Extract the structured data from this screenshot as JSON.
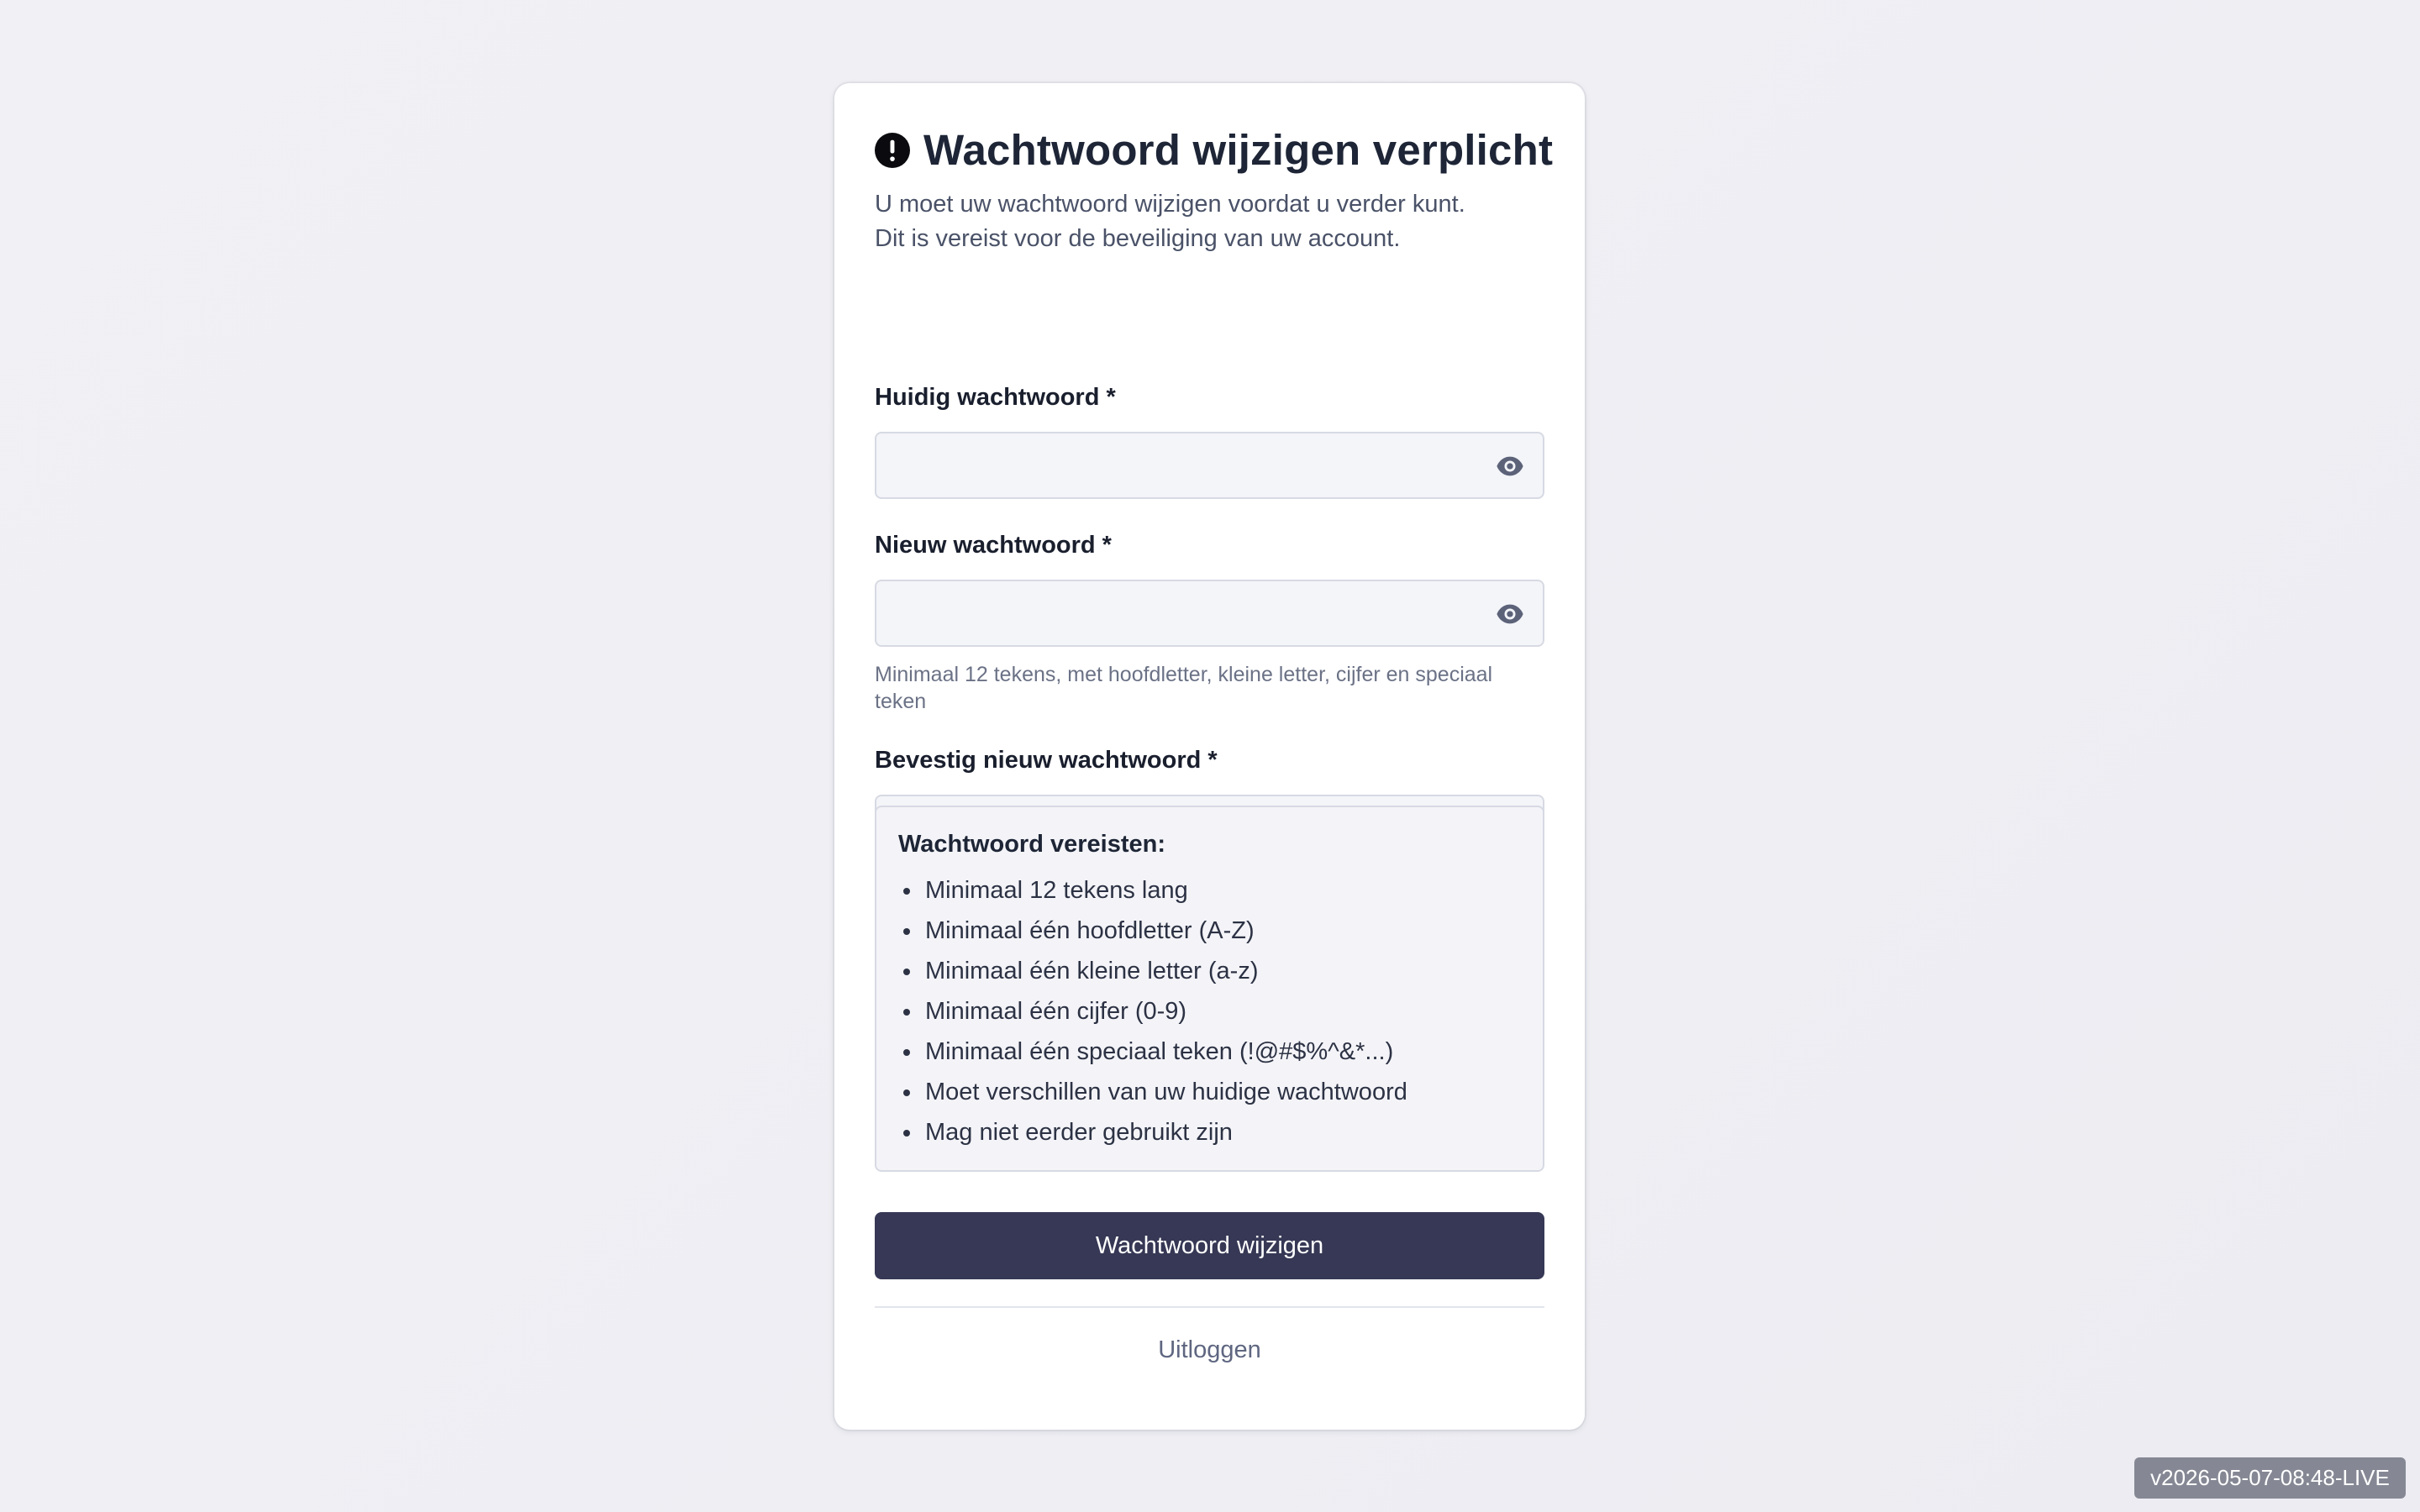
{
  "card": {
    "title": "Wachtwoord wijzigen verplicht",
    "subtitle_line1": "U moet uw wachtwoord wijzigen voordat u verder kunt.",
    "subtitle_line2": "Dit is vereist voor de beveiliging van uw account."
  },
  "fields": {
    "current": {
      "label": "Huidig wachtwoord *",
      "value": "",
      "placeholder": ""
    },
    "new": {
      "label": "Nieuw wachtwoord *",
      "value": "",
      "placeholder": "",
      "hint": "Minimaal 12 tekens, met hoofdletter, kleine letter, cijfer en speciaal teken"
    },
    "confirm": {
      "label": "Bevestig nieuw wachtwoord *",
      "value": "",
      "placeholder": ""
    }
  },
  "requirements": {
    "title": "Wachtwoord vereisten:",
    "items": [
      "Minimaal 12 tekens lang",
      "Minimaal één hoofdletter (A-Z)",
      "Minimaal één kleine letter (a-z)",
      "Minimaal één cijfer (0-9)",
      "Minimaal één speciaal teken (!@#$%^&*...)",
      "Moet verschillen van uw huidige wachtwoord",
      "Mag niet eerder gebruikt zijn"
    ]
  },
  "actions": {
    "submit_label": "Wachtwoord wijzigen",
    "logout_label": "Uitloggen"
  },
  "version_badge": "v2026-05-07-08:48-LIVE",
  "icons": {
    "title_icon": "alert-circle-icon",
    "toggle_icon": "eye-icon"
  },
  "colors": {
    "primary_button": "#363855",
    "background": "#efeff4",
    "input_background": "#f4f5f9"
  }
}
